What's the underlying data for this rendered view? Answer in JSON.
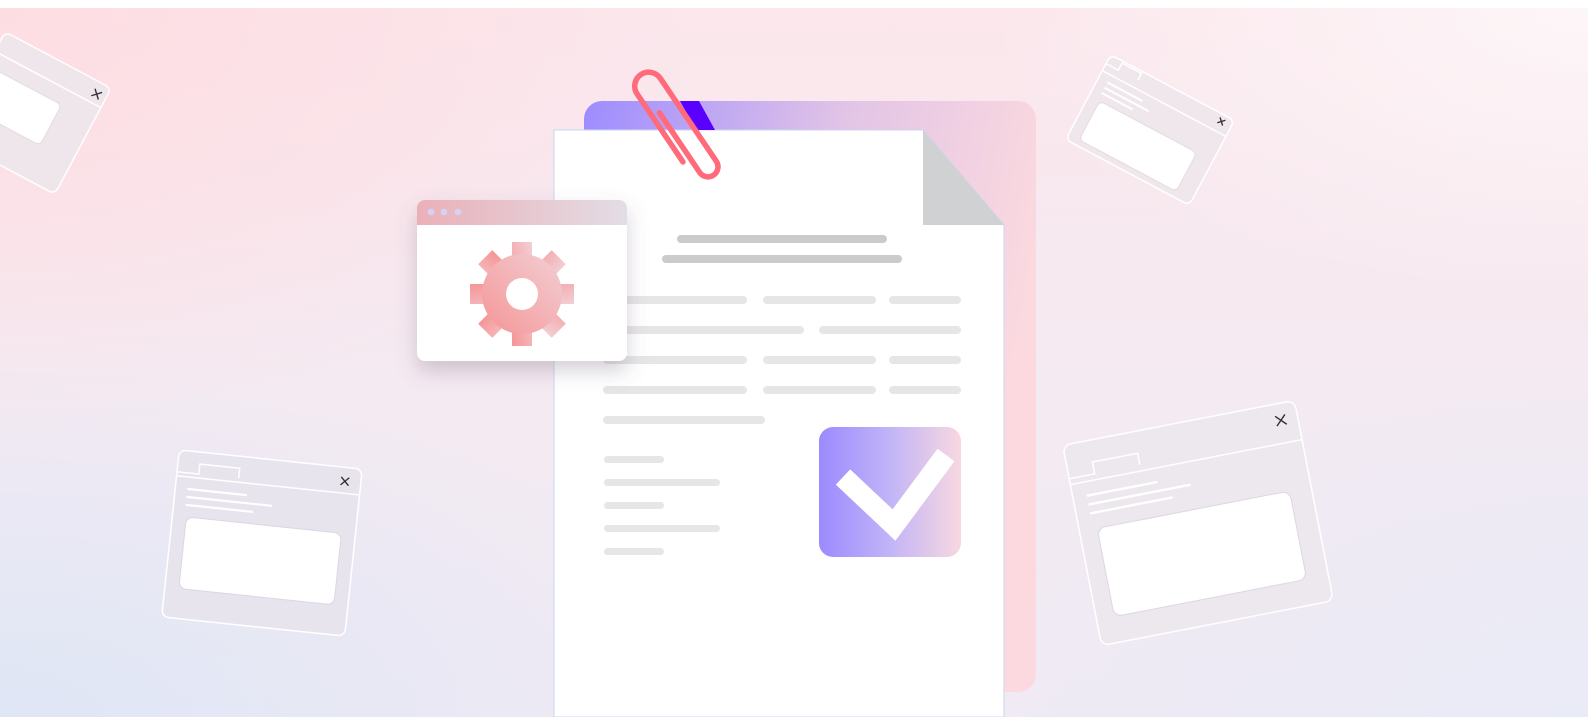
{
  "illustration": {
    "colors": {
      "accent_purple": "#9d8cff",
      "accent_pink": "#fbd9df",
      "clip_tab": "#5a00ff",
      "paperclip": "#ff6b7a",
      "gear_start": "#f59c9e",
      "gear_end": "#f3c6cc",
      "line_dark": "#cbcbcb",
      "line_light": "#e6e6e6",
      "corner_fold": "#d0d1d3"
    },
    "icons": {
      "paperclip": "paperclip-icon",
      "gear": "gear-icon",
      "checkmark": "checkmark-icon",
      "close": "close-icon"
    }
  }
}
